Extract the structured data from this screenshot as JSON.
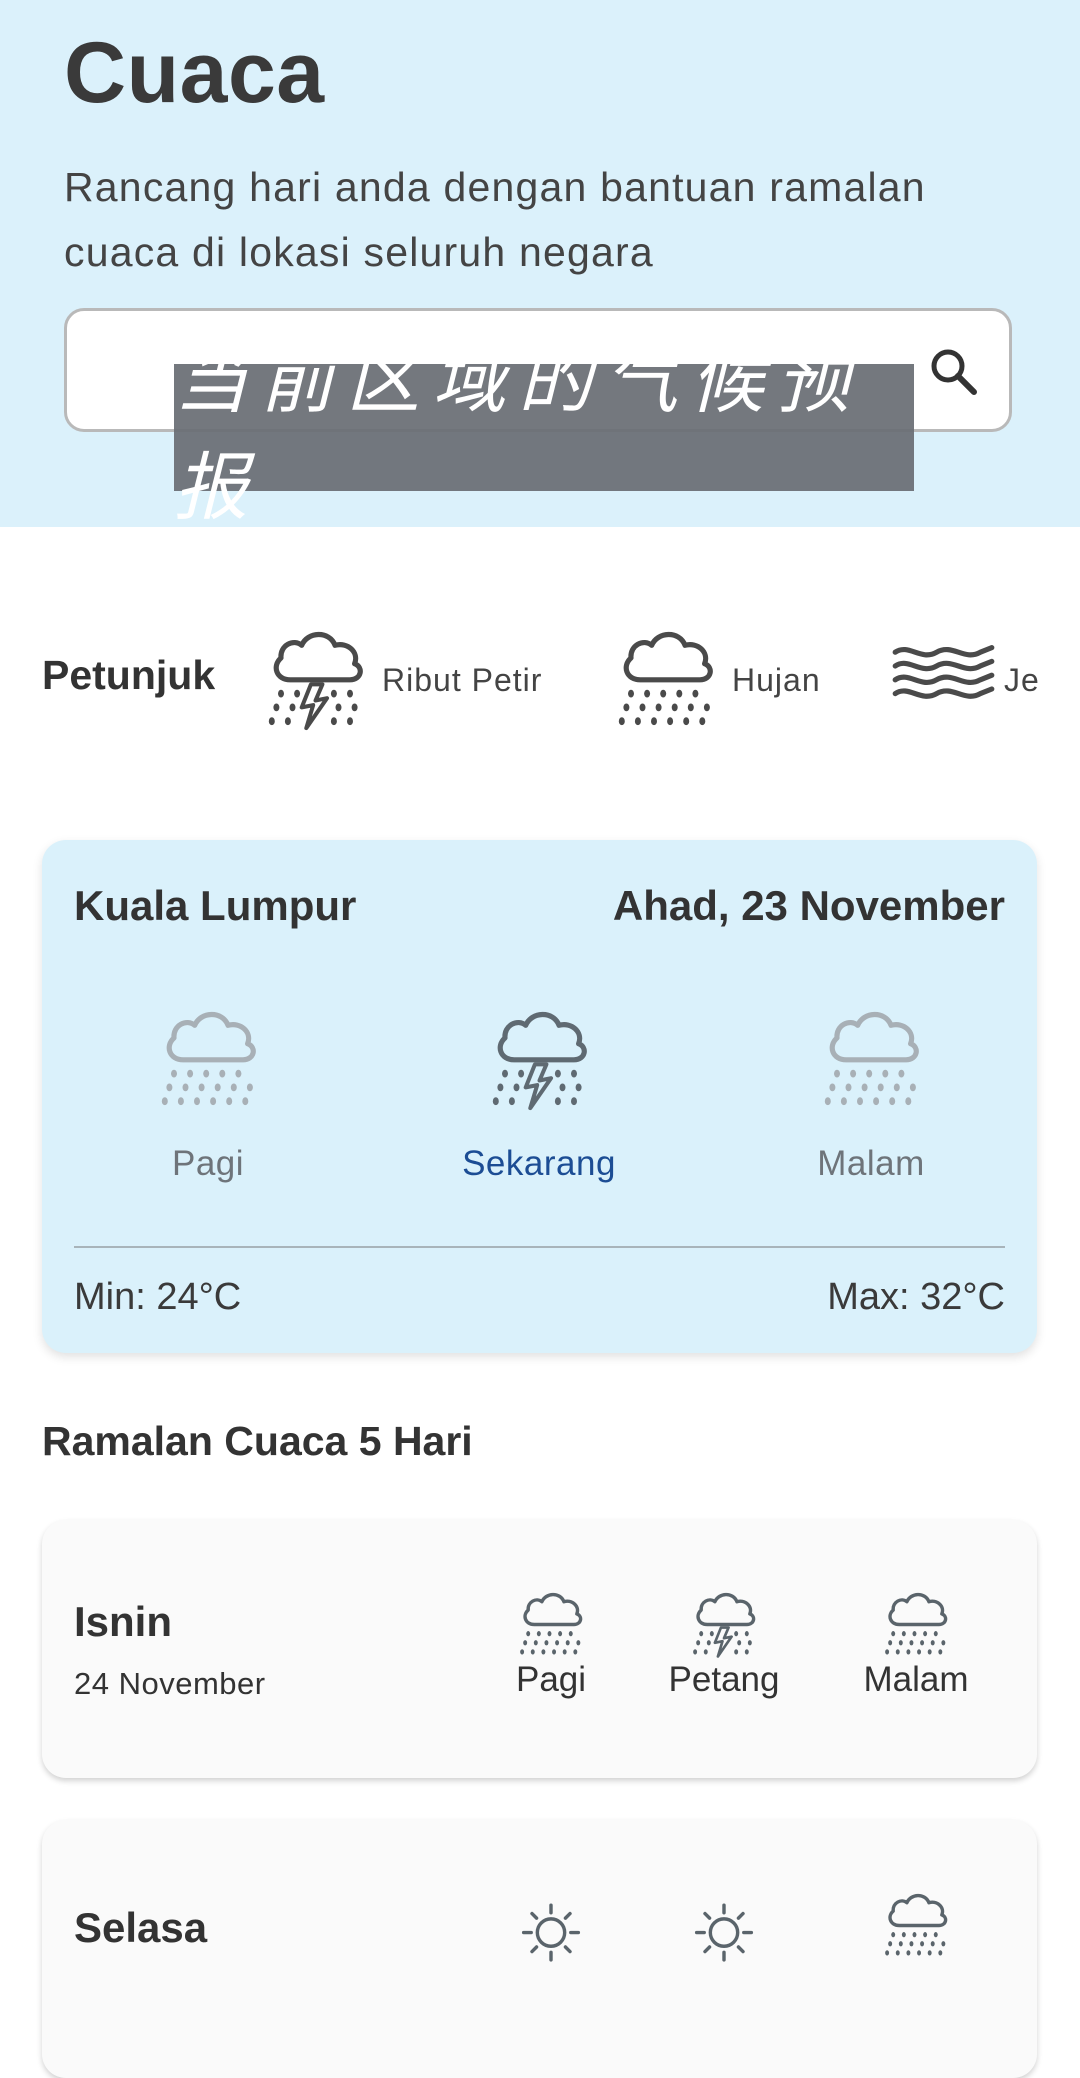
{
  "header": {
    "title": "Cuaca",
    "subtitle": "Rancang hari anda dengan bantuan ramalan cuaca di lokasi seluruh negara",
    "search": {
      "value": "",
      "placeholder": ""
    },
    "overlay_caption": "当前区域的气候预报",
    "background_color": "#dbf1fb"
  },
  "legend": {
    "title": "Petunjuk",
    "items": [
      {
        "label": "Ribut Petir",
        "icon": "thunderstorm-icon"
      },
      {
        "label": "Hujan",
        "icon": "rain-icon"
      },
      {
        "label": "Jerebu",
        "icon": "haze-icon"
      }
    ]
  },
  "today": {
    "location": "Kuala Lumpur",
    "date": "Ahad, 23 November",
    "periods": [
      {
        "label": "Pagi",
        "icon": "rain-icon",
        "active": false
      },
      {
        "label": "Sekarang",
        "icon": "thunderstorm-icon",
        "active": true
      },
      {
        "label": "Malam",
        "icon": "rain-icon",
        "active": false
      }
    ],
    "min": "Min: 24°C",
    "max": "Max: 32°C",
    "card_color": "#daf1fb",
    "active_color": "#1c4d94"
  },
  "forecast": {
    "title": "Ramalan Cuaca 5 Hari",
    "days": [
      {
        "day": "Isnin",
        "date": "24 November",
        "periods": [
          {
            "label": "Pagi",
            "icon": "rain-icon"
          },
          {
            "label": "Petang",
            "icon": "thunderstorm-icon"
          },
          {
            "label": "Malam",
            "icon": "rain-icon"
          }
        ]
      },
      {
        "day": "Selasa",
        "date": "",
        "periods": [
          {
            "label": "",
            "icon": "sun-icon"
          },
          {
            "label": "",
            "icon": "sun-icon"
          },
          {
            "label": "",
            "icon": "rain-icon"
          }
        ]
      }
    ]
  }
}
